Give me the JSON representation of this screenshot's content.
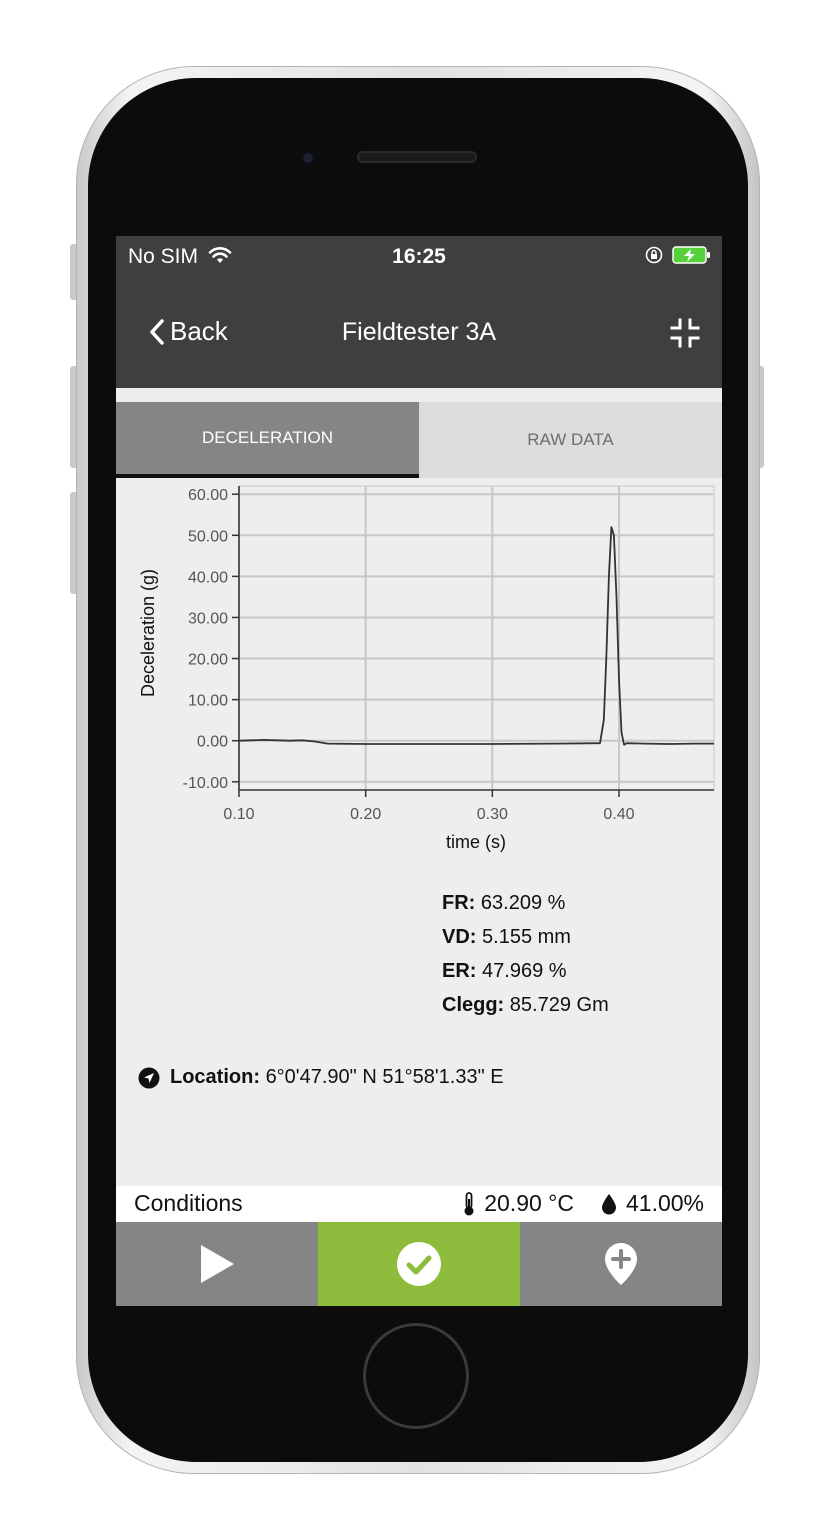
{
  "status_bar": {
    "carrier": "No SIM",
    "time": "16:25",
    "battery_color": "#57d13b"
  },
  "nav": {
    "back_label": "Back",
    "title": "Fieldtester 3A"
  },
  "tabs": [
    {
      "label": "DECELERATION",
      "active": true
    },
    {
      "label": "RAW DATA",
      "active": false
    }
  ],
  "chart_data": {
    "type": "line",
    "xlabel": "time (s)",
    "ylabel": "Deceleration (g)",
    "xlim": [
      0.1,
      0.475
    ],
    "ylim": [
      -12,
      62
    ],
    "x_ticks": [
      0.1,
      0.2,
      0.3,
      0.4
    ],
    "x_tick_labels": [
      "0.10",
      "0.20",
      "0.30",
      "0.40"
    ],
    "y_ticks": [
      60,
      50,
      40,
      30,
      20,
      10,
      0,
      -10
    ],
    "y_tick_labels": [
      "60.00",
      "50.00",
      "40.00",
      "30.00",
      "20.00",
      "10.00",
      "0.00",
      "-10.00"
    ],
    "grid": true,
    "series": [
      {
        "color": "#333333",
        "x": [
          0.1,
          0.12,
          0.14,
          0.15,
          0.16,
          0.17,
          0.2,
          0.25,
          0.3,
          0.35,
          0.385,
          0.388,
          0.39,
          0.392,
          0.394,
          0.396,
          0.398,
          0.4,
          0.402,
          0.404,
          0.406,
          0.42,
          0.44,
          0.46,
          0.475
        ],
        "y": [
          0.0,
          0.2,
          0.0,
          0.1,
          -0.2,
          -0.7,
          -0.8,
          -0.8,
          -0.8,
          -0.7,
          -0.6,
          5.0,
          20.0,
          40.0,
          52.0,
          50.0,
          35.0,
          15.0,
          2.0,
          -1.0,
          -0.6,
          -0.7,
          -0.8,
          -0.7,
          -0.7
        ]
      }
    ]
  },
  "stats": [
    {
      "label": "FR:",
      "value": "63.209 %"
    },
    {
      "label": "VD:",
      "value": "5.155 mm"
    },
    {
      "label": "ER:",
      "value": "47.969 %"
    },
    {
      "label": "Clegg:",
      "value": "85.729 Gm"
    }
  ],
  "location": {
    "label": "Location:",
    "value": "6°0'47.90\" N 51°58'1.33\" E"
  },
  "conditions": {
    "label": "Conditions",
    "temperature": "20.90 °C",
    "humidity": "41.00%"
  },
  "toolbar": {
    "accent_color": "#8dbb3c",
    "buttons": [
      {
        "icon": "play-icon"
      },
      {
        "icon": "check-circle-icon"
      },
      {
        "icon": "map-marker-plus-icon"
      }
    ]
  }
}
